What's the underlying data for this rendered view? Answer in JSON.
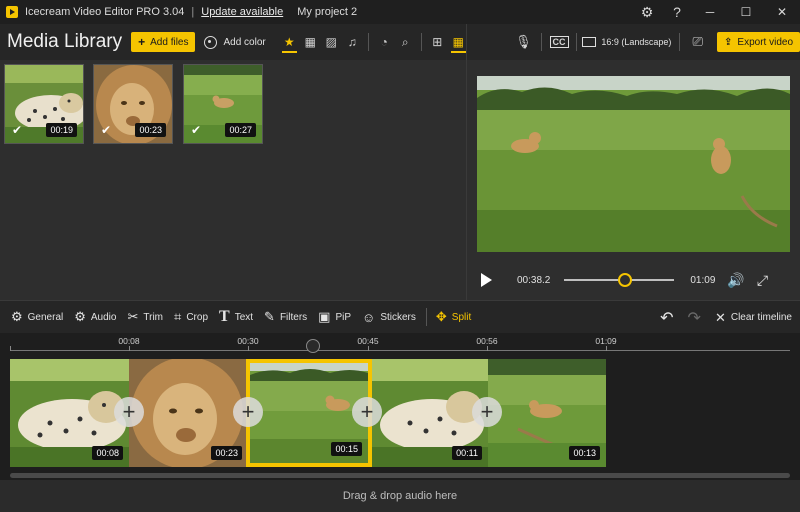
{
  "titlebar": {
    "app_name": "Icecream Video Editor PRO 3.04",
    "separator": "|",
    "update_link": "Update available",
    "project_name": "My project 2",
    "settings_icon": "gear-icon",
    "help": "?",
    "minimize": "─",
    "maximize": "☐",
    "close": "✕"
  },
  "library": {
    "title": "Media Library",
    "add_files_label": "Add files",
    "add_color_label": "Add color",
    "filters": [
      "star-icon",
      "video-icon",
      "image-icon",
      "music-icon",
      "stopwatch-icon",
      "search-icon",
      "grid-large-icon",
      "grid-small-icon",
      "collapse-icon"
    ],
    "items": [
      {
        "name": "cheetah",
        "duration": "00:19",
        "used": true
      },
      {
        "name": "lion",
        "duration": "00:23",
        "used": true
      },
      {
        "name": "lions-savanna",
        "duration": "00:27",
        "used": true
      }
    ]
  },
  "preview": {
    "mic_icon": "microphone-icon",
    "cc_icon": "captions-icon",
    "aspect_label": "16:9 (Landscape)",
    "camera_icon": "camera-icon",
    "export_label": "Export video",
    "current_time": "00:38.2",
    "total_time": "01:09",
    "progress": 0.55
  },
  "edit_toolbar": {
    "tools": [
      {
        "id": "general",
        "label": "General",
        "icon": "⚙"
      },
      {
        "id": "audio",
        "label": "Audio",
        "icon": "⚙"
      },
      {
        "id": "trim",
        "label": "Trim",
        "icon": "✂"
      },
      {
        "id": "crop",
        "label": "Crop",
        "icon": "⌗"
      },
      {
        "id": "text",
        "label": "Text",
        "icon": "T"
      },
      {
        "id": "filters",
        "label": "Filters",
        "icon": "✎"
      },
      {
        "id": "pip",
        "label": "PiP",
        "icon": "▣"
      },
      {
        "id": "stickers",
        "label": "Stickers",
        "icon": "☺"
      },
      {
        "id": "split",
        "label": "Split",
        "icon": "✥"
      }
    ],
    "clear_label": "Clear timeline"
  },
  "timeline": {
    "ticks": [
      "00:08",
      "00:30",
      "00:45",
      "00:56",
      "01:09"
    ],
    "clips": [
      {
        "name": "cheetah",
        "duration": "00:08",
        "selected": false
      },
      {
        "name": "lion",
        "duration": "00:23",
        "selected": false
      },
      {
        "name": "lions-savanna",
        "duration": "00:15",
        "selected": true
      },
      {
        "name": "cheetah",
        "duration": "00:11",
        "selected": false
      },
      {
        "name": "lions-savanna",
        "duration": "00:13",
        "selected": false
      }
    ],
    "audio_drop_label": "Drag & drop audio here"
  },
  "colors": {
    "accent": "#f5c400",
    "background": "#2b2b2b",
    "toolbar": "#262626",
    "timeline": "#1e1e1e"
  }
}
